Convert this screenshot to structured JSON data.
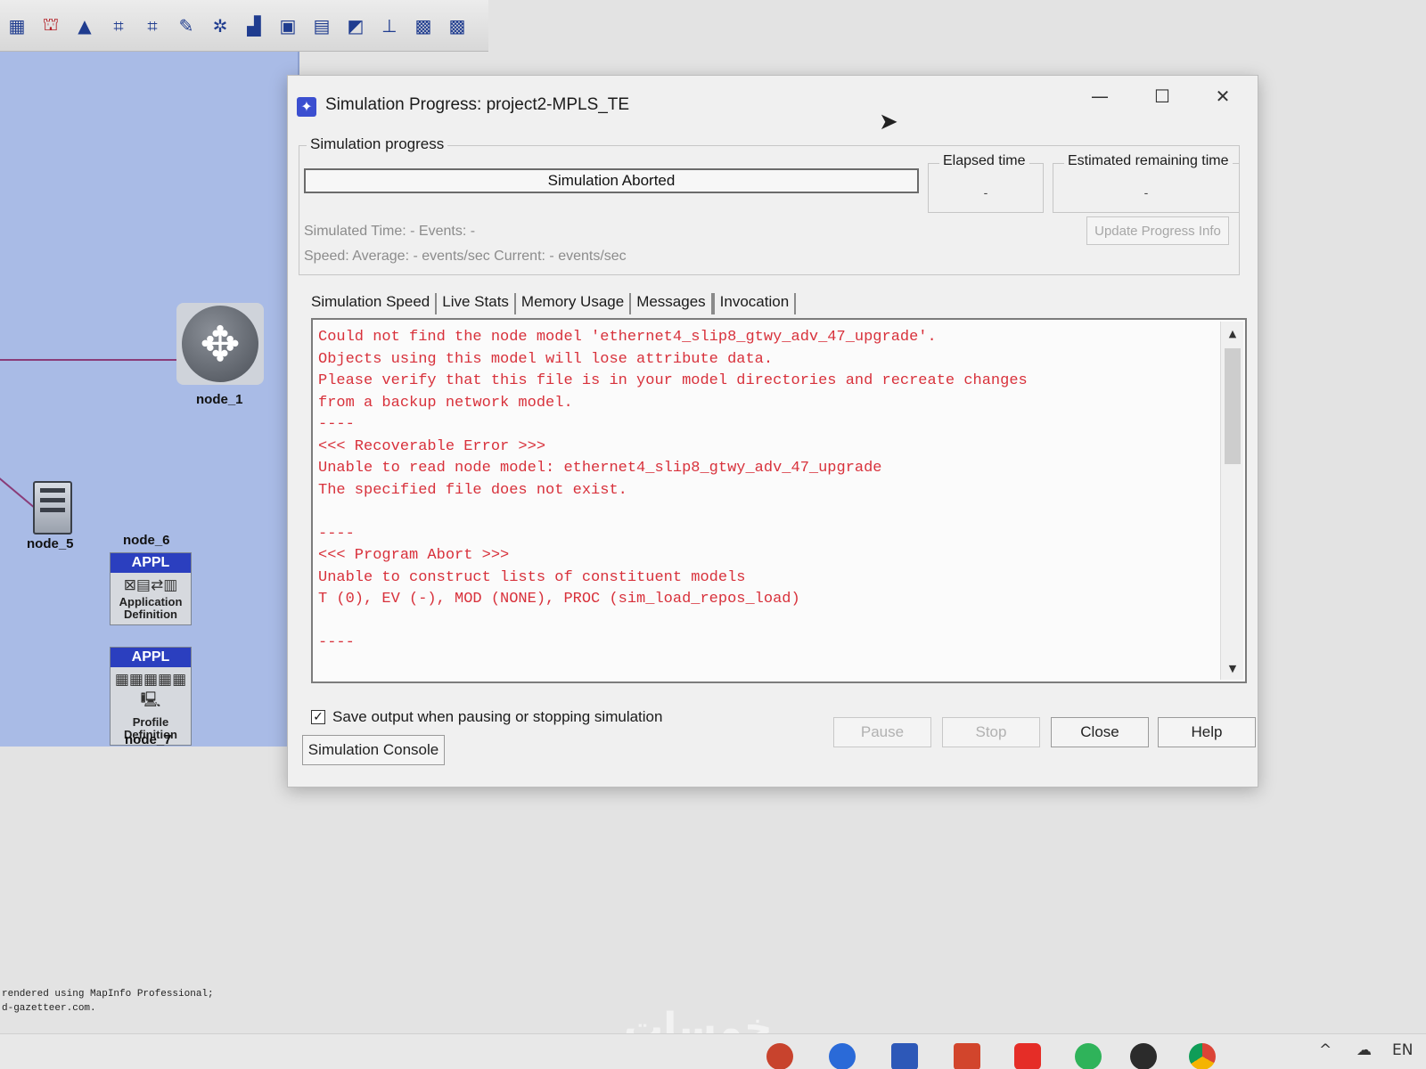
{
  "toolbar": {
    "icons": [
      "db",
      "gift",
      "triangle",
      "net-a",
      "net-b",
      "pin",
      "star-net",
      "scatter",
      "doc-bs",
      "sheet",
      "chart",
      "meter",
      "ipv6",
      "ipv4"
    ],
    "glyphs": [
      "▦",
      "⛫",
      "▲",
      "⌗",
      "⌗",
      "✎",
      "✲",
      "▟",
      "▣",
      "▤",
      "◩",
      "⊥",
      "▩",
      "▩"
    ]
  },
  "canvas": {
    "router_glyph": "✥",
    "node_1": "node_1",
    "node_5": "node_5",
    "node_6": "node_6",
    "node_7": "node_7",
    "appl_header": "APPL",
    "app_def_glyphs": "⊠▤⇄▥",
    "app_def_caption": "Application Definition",
    "profile_header": "APPL",
    "profile_glyphs": "▦▦▦▦▦ 🖳",
    "profile_caption": "Profile Definition",
    "mapinfo_line1": "rendered using MapInfo Professional;",
    "mapinfo_line2": "d-gazetteer.com."
  },
  "dialog": {
    "title": "Simulation Progress: project2-MPLS_TE",
    "icon": "✦",
    "window_controls": [
      "—",
      "☐",
      "✕"
    ],
    "group_label": "Simulation progress",
    "progress_status": "Simulation Aborted",
    "progress_fraction": 0,
    "elapsed_label": "Elapsed time",
    "elapsed_value": "-",
    "remaining_label": "Estimated remaining time",
    "remaining_value": "-",
    "simulated_line": "Simulated Time:  -  Events:  -",
    "speed_line": "Speed:  Average:  -  events/sec  Current:  -  events/sec",
    "update_button": "Update Progress Info",
    "tabs": [
      "Simulation Speed",
      "Live Stats",
      "Memory Usage",
      "Messages",
      "Invocation"
    ],
    "active_tab": "Invocation",
    "console_text": "Could not find the node model 'ethernet4_slip8_gtwy_adv_47_upgrade'.\nObjects using this model will lose attribute data.\nPlease verify that this file is in your model directories and recreate changes\nfrom a backup network model.\n----\n<<< Recoverable Error >>>\nUnable to read node model: ethernet4_slip8_gtwy_adv_47_upgrade\nThe specified file does not exist.\n\n----\n<<< Program Abort >>>\nUnable to construct lists of constituent models\nT (0), EV (-), MOD (NONE), PROC (sim_load_repos_load)\n\n----",
    "save_checked": true,
    "save_label": "Save output when pausing or stopping simulation",
    "console_button": "Simulation Console",
    "pause_button": "Pause",
    "stop_button": "Stop",
    "close_button": "Close",
    "help_button": "Help"
  },
  "taskbar": {
    "tray_chevron": "^",
    "tray_cloud": "☁",
    "language": "EN",
    "watermark": "خمسات"
  },
  "colors": {
    "console_error": "#d8313b",
    "canvas_bg": "#a9bbe6",
    "appl_header": "#2b3fbf"
  }
}
